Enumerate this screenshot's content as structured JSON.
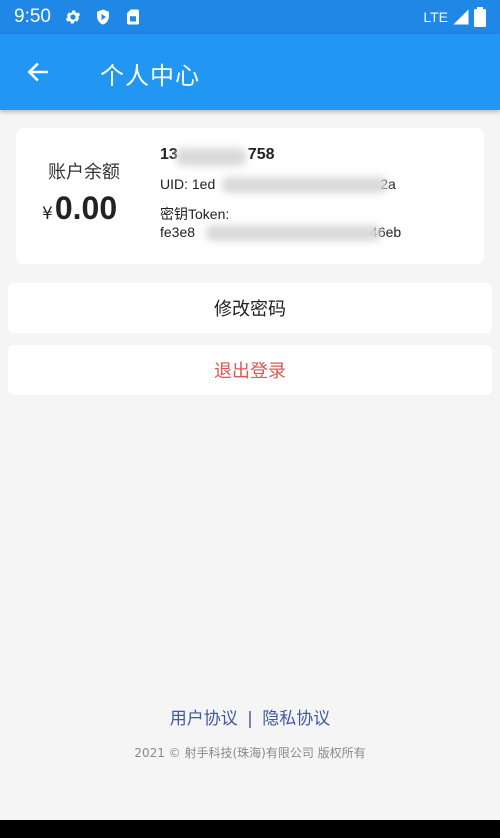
{
  "status_bar": {
    "time": "9:50",
    "network": "LTE"
  },
  "app_bar": {
    "title": "个人中心"
  },
  "account": {
    "balance_label": "账户余额",
    "currency": "¥",
    "balance": "0.00",
    "phone_prefix": "13",
    "phone_suffix": "758",
    "uid_prefix": "UID: 1ed",
    "uid_suffix": "2a",
    "token_label": "密钥Token:",
    "token_prefix": "fe3e8",
    "token_suffix": "46eb"
  },
  "actions": {
    "change_password": "修改密码",
    "logout": "退出登录"
  },
  "footer": {
    "user_agreement": "用户协议",
    "separator": "|",
    "privacy_policy": "隐私协议",
    "copyright": "2021 © 射手科技(珠海)有限公司 版权所有"
  },
  "colors": {
    "primary": "#2196f3",
    "danger": "#e05555",
    "link": "#3d5aa5"
  }
}
